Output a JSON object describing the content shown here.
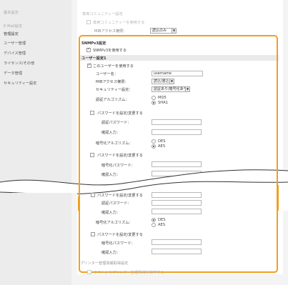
{
  "sidebar": {
    "items": [
      {
        "label": "基本設定",
        "dim": true
      },
      {
        "label": "E-Mail設定",
        "dim": true
      },
      {
        "label": "データ入出力設定",
        "dim": true
      },
      {
        "label": "管理設定",
        "dim": false,
        "head": true
      },
      {
        "label": "ユーザー管理",
        "dim": false
      },
      {
        "label": "デバイス管理",
        "dim": false
      },
      {
        "label": "ライセンス/その他",
        "dim": false
      },
      {
        "label": "データ管理",
        "dim": false
      },
      {
        "label": "セキュリティー設定",
        "dim": false
      }
    ]
  },
  "top_faded": {
    "section": "専用コミュニティー設定",
    "checkbox_label": "専用コミュニティーを使用する",
    "mib_access_label": "MIBアクセス権限：",
    "mib_access_value": "読込のみ"
  },
  "snmpv3": {
    "section_title": "SNMPv3設定",
    "enable_label": "SNMPv3を使用する",
    "user_setting_title": "ユーザー設定1",
    "use_user_label": "このユーザーを使用する",
    "username_label": "ユーザー名：",
    "username_value": "username",
    "mib_access_label": "MIBアクセス権限：",
    "mib_access_value": "読込/書込",
    "security_label": "セキュリティー設定：",
    "security_value": "認証あり/暗号化あり",
    "auth_algo_label": "認証アルゴリズム：",
    "auth_algo_options": [
      "MD5",
      "SHA1"
    ],
    "auth_pw_set_label": "パスワードを設定/変更する",
    "auth_pw_label": "認証パスワード：",
    "confirm_label": "確認入力：",
    "enc_algo_label": "暗号化アルゴリズム：",
    "enc_algo_options": [
      "DES",
      "AES"
    ],
    "enc_pw_set_label": "パスワードを設定/変更する",
    "enc_pw_label": "暗号化パスワード：",
    "confirm2_label": "確認入力："
  },
  "lower": {
    "auth_pw_set_label": "パスワードを設定/変更する",
    "auth_pw_label": "認証パスワード：",
    "confirm_label": "確認入力：",
    "enc_algo_label": "暗号化アルゴリズム：",
    "enc_algo_options": [
      "DES",
      "AES"
    ],
    "enc_pw_set_label": "パスワードを設定/変更する",
    "enc_pw_label": "暗号化パスワード：",
    "confirm2_label": "確認入力："
  },
  "bottom_faded": {
    "section": "プリンター管理情報取得設定",
    "checkbox_label": "ホストからプリンター管理情報を取得する"
  },
  "colors": {
    "highlight": "#f0a020",
    "sidebar_bg": "#ececec"
  }
}
